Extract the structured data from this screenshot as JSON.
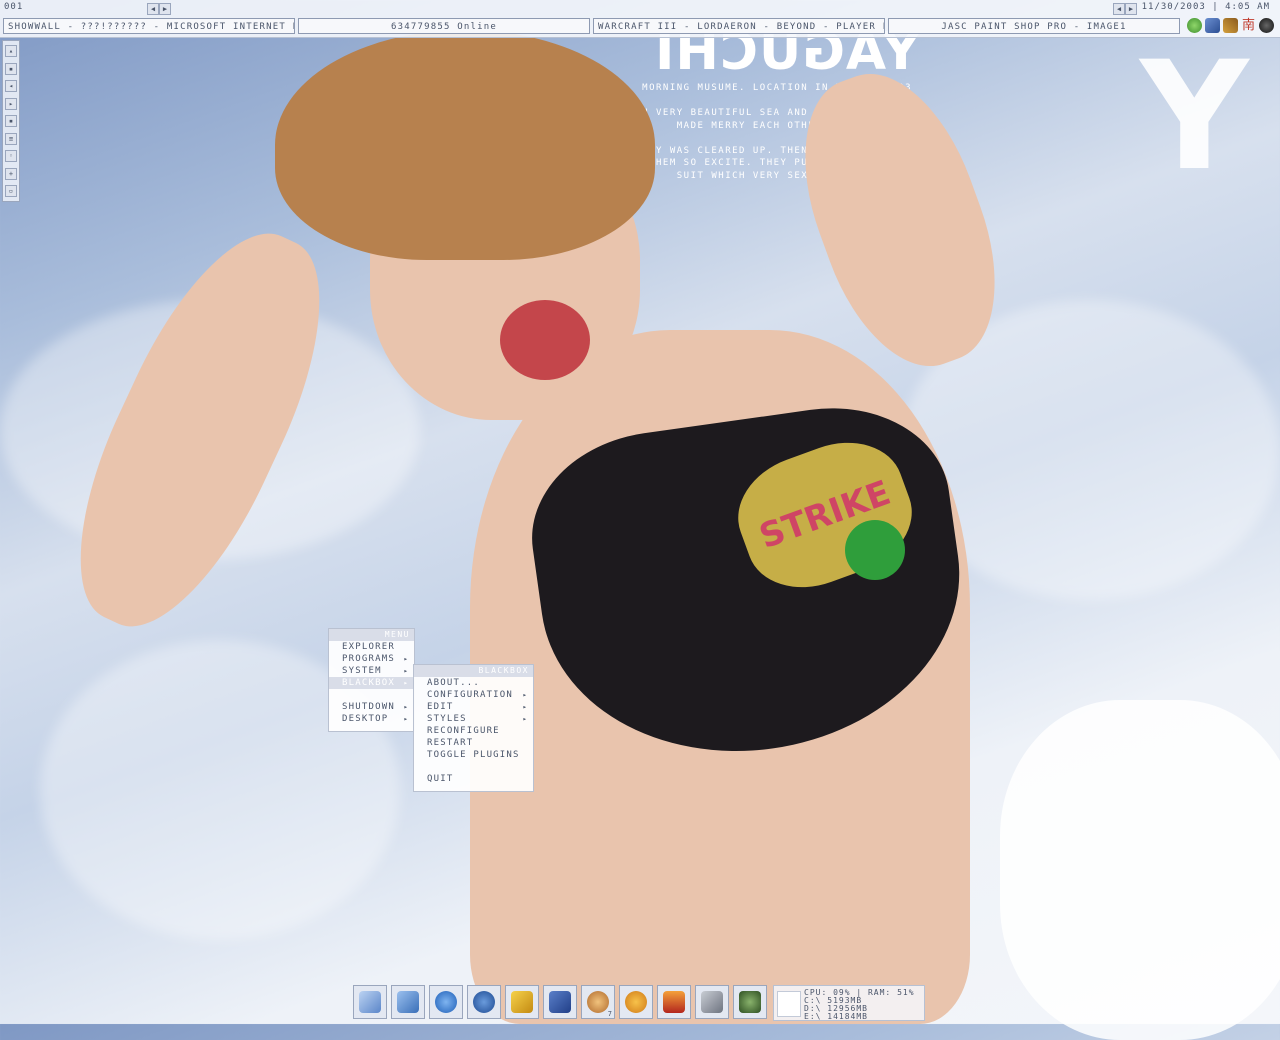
{
  "topbar": {
    "workspace": "001",
    "clock": "11/30/2003 | 4:05 AM",
    "tasks": [
      "SHOWWALL - ???!?????? - MICROSOFT INTERNET E...",
      "634779855 Online",
      "WARCRAFT III - LORDAERON - BEYOND - PLAYER F...",
      "JASC PAINT SHOP PRO - IMAGE1"
    ],
    "tray_icons": [
      "globe-icon",
      "network-icon",
      "pencil-icon",
      "chinese-char-icon",
      "speaker-icon"
    ],
    "tray_char": "南"
  },
  "wallpaper": {
    "title": "YAGUCHI",
    "caption_lines": [
      "MORNING MUSUME. LOCATION IN HAWAII 2003 AUG.",
      "ON VERY BEAUTIFUL SEA AND SKY. THEY WERE",
      "MADE MERRY EACH OTHER. IT WAS VERY ENERGETIC.",
      "THE SKY WAS CLEARED UP. THEN THE SEA'S BLUE",
      "MADE THEM SO EXCITE. THEY PUT ON A SWIMMING",
      "SUIT WHICH VERY SEXY OR VERY CUTE."
    ],
    "bikini_text": "STRIKE"
  },
  "menu": {
    "title": "MENU",
    "items": [
      "EXPLORER",
      "PROGRAMS",
      "SYSTEM",
      "BLACKBOX",
      "",
      "SHUTDOWN",
      "DESKTOP"
    ]
  },
  "submenu": {
    "title": "BLACKBOX",
    "items": [
      "ABOUT...",
      "CONFIGURATION",
      "EDIT",
      "STYLES",
      "RECONFIGURE",
      "RESTART",
      "TOGGLE PLUGINS",
      "",
      "QUIT"
    ]
  },
  "dock": {
    "icons": [
      "my-computer-icon",
      "notepad-icon",
      "internet-explorer-icon",
      "maxthon-icon",
      "winamp-icon",
      "word-icon",
      "paint-icon",
      "messenger-icon",
      "warcraft-icon",
      "counter-strike-icon",
      "dragon-icon"
    ],
    "badge": "7"
  },
  "sysmon": {
    "cpu_ram": "CPU: 09% | RAM: 51%",
    "c": "C:\\ 5193MB",
    "d": "D:\\ 12956MB",
    "e": "E:\\ 14184MB"
  },
  "colors": {
    "menu_highlight": "#d9dde8",
    "text": "#4b566b",
    "border": "#9aa6bd"
  }
}
